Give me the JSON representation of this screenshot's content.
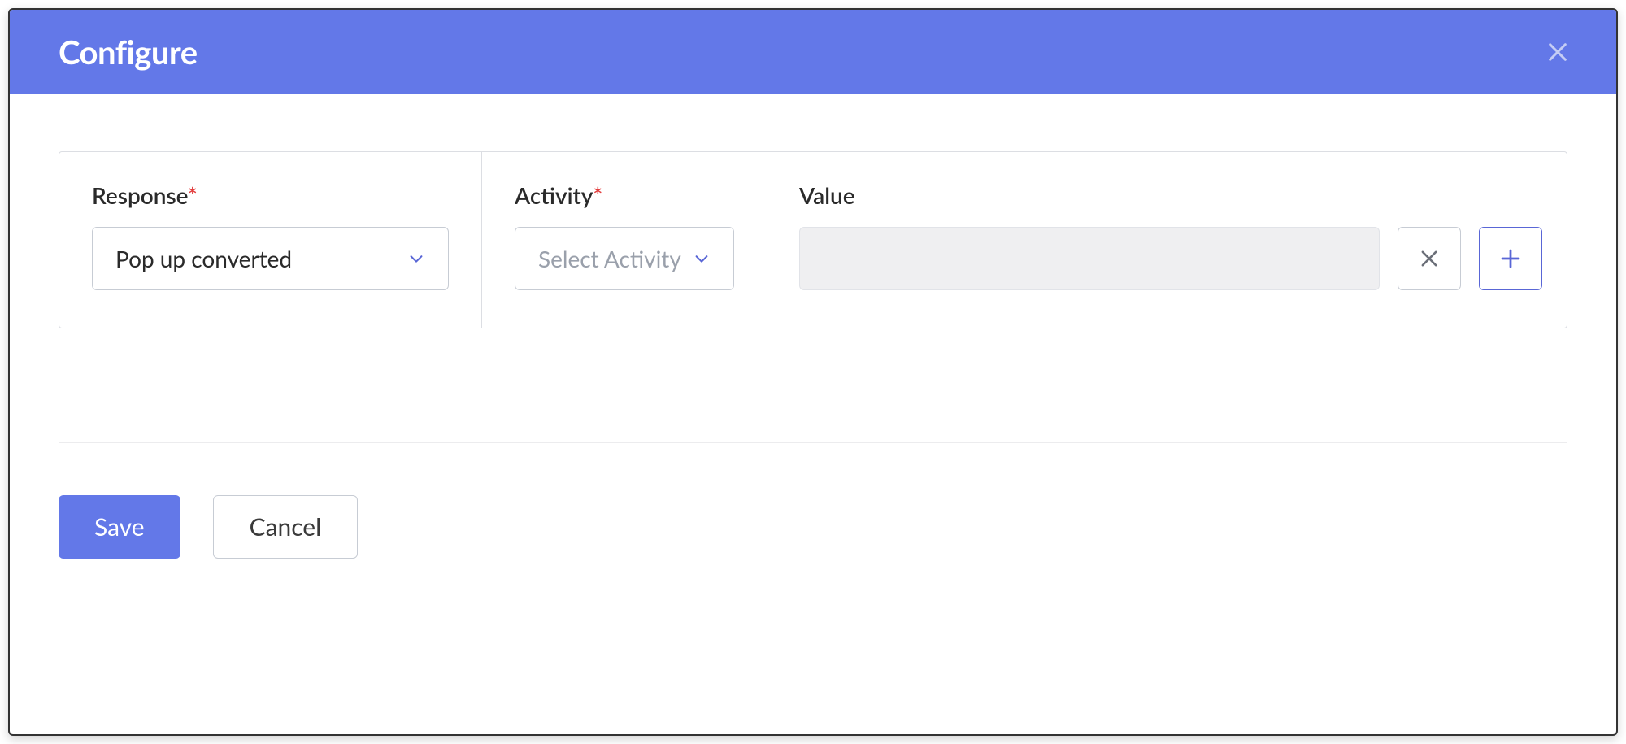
{
  "header": {
    "title": "Configure"
  },
  "form": {
    "response": {
      "label": "Response",
      "required": "*",
      "selected": "Pop up converted"
    },
    "activity": {
      "label": "Activity",
      "required": "*",
      "placeholder": "Select Activity"
    },
    "value": {
      "label": "Value",
      "input_value": ""
    }
  },
  "actions": {
    "save": "Save",
    "cancel": "Cancel"
  }
}
